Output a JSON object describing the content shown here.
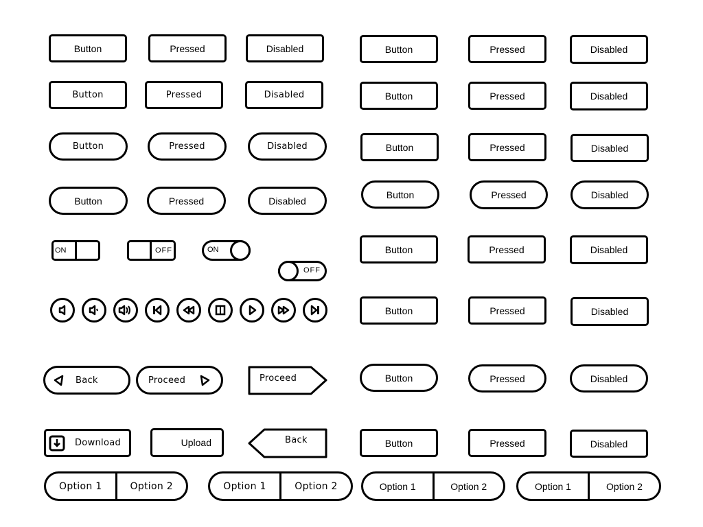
{
  "labels": {
    "button": "Button",
    "pressed": "Pressed",
    "disabled": "Disabled"
  },
  "left_grid": {
    "rows": [
      {
        "style": "rounded-rect",
        "items": [
          "Button",
          "Pressed",
          "Disabled"
        ]
      },
      {
        "style": "rounded-rect-sketch",
        "items": [
          "Button",
          "Pressed",
          "Disabled"
        ]
      },
      {
        "style": "pill-sketch",
        "items": [
          "Button",
          "Pressed",
          "Disabled"
        ]
      },
      {
        "style": "pill",
        "items": [
          "Button",
          "Pressed",
          "Disabled"
        ]
      }
    ]
  },
  "right_grid": {
    "rows": [
      {
        "style": "rounded-rect",
        "items": [
          "Button",
          "Pressed",
          "Disabled"
        ]
      },
      {
        "style": "rounded-rect",
        "items": [
          "Button",
          "Pressed",
          "Disabled"
        ]
      },
      {
        "style": "rounded-rect",
        "items": [
          "Button",
          "Pressed",
          "Disabled"
        ]
      },
      {
        "style": "pill",
        "items": [
          "Button",
          "Pressed",
          "Disabled"
        ]
      },
      {
        "style": "rounded-rect",
        "items": [
          "Button",
          "Pressed",
          "Disabled"
        ]
      },
      {
        "style": "rounded-rect",
        "items": [
          "Button",
          "Pressed",
          "Disabled"
        ]
      },
      {
        "style": "pill",
        "items": [
          "Button",
          "Pressed",
          "Disabled"
        ]
      },
      {
        "style": "rounded-rect",
        "items": [
          "Button",
          "Pressed",
          "Disabled"
        ]
      }
    ]
  },
  "toggles": [
    {
      "type": "rect",
      "state": "on",
      "label": "ON"
    },
    {
      "type": "rect",
      "state": "off",
      "label": "OFF"
    },
    {
      "type": "pill",
      "state": "on",
      "label": "ON"
    },
    {
      "type": "pill",
      "state": "off",
      "label": "OFF"
    }
  ],
  "media_controls": [
    "volume-mute-icon",
    "volume-low-icon",
    "volume-high-icon",
    "skip-back-icon",
    "rewind-icon",
    "pause-icon",
    "play-icon",
    "fast-forward-icon",
    "skip-forward-icon"
  ],
  "nav_buttons": {
    "back_pill": "Back",
    "proceed_pill": "Proceed",
    "proceed_arrow": "Proceed",
    "download": "Download",
    "upload": "Upload",
    "back_arrow": "Back"
  },
  "segmented_controls": [
    {
      "options": [
        "Option 1",
        "Option 2"
      ]
    },
    {
      "options": [
        "Option 1",
        "Option 2"
      ]
    },
    {
      "options": [
        "Option 1",
        "Option 2"
      ]
    },
    {
      "options": [
        "Option 1",
        "Option 2"
      ]
    }
  ]
}
